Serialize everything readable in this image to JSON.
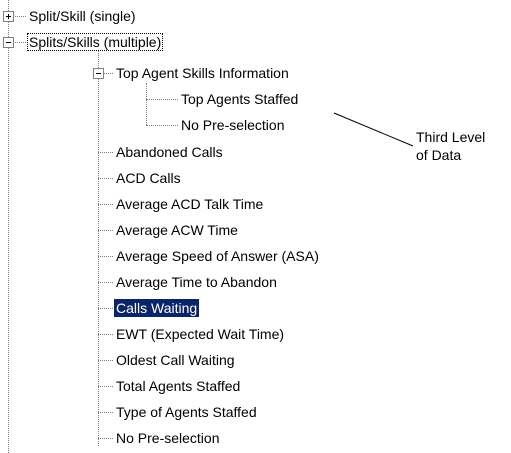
{
  "tree": {
    "level1": [
      {
        "label": "Split/Skill (single)",
        "expanded": false
      },
      {
        "label": "Splits/Skills (multiple)",
        "expanded": true
      }
    ],
    "group": {
      "label": "Top Agent Skills Information",
      "expanded": true
    },
    "level3": [
      {
        "label": "Top Agents Staffed"
      },
      {
        "label": "No Pre-selection"
      }
    ],
    "level2": [
      {
        "label": "Abandoned Calls"
      },
      {
        "label": "ACD Calls"
      },
      {
        "label": "Average ACD Talk Time"
      },
      {
        "label": "Average ACW Time"
      },
      {
        "label": "Average Speed of Answer (ASA)"
      },
      {
        "label": "Average Time to Abandon"
      },
      {
        "label": "Calls Waiting",
        "selected": true
      },
      {
        "label": "EWT (Expected Wait Time)"
      },
      {
        "label": "Oldest Call Waiting"
      },
      {
        "label": "Total Agents Staffed"
      },
      {
        "label": "Type of Agents Staffed"
      },
      {
        "label": "No Pre-selection"
      }
    ]
  },
  "annotation": {
    "line1": "Third Level",
    "line2": "of Data"
  },
  "colors": {
    "selection_bg": "#0a246a",
    "selection_fg": "#ffffff",
    "tree_lines": "#808080"
  }
}
